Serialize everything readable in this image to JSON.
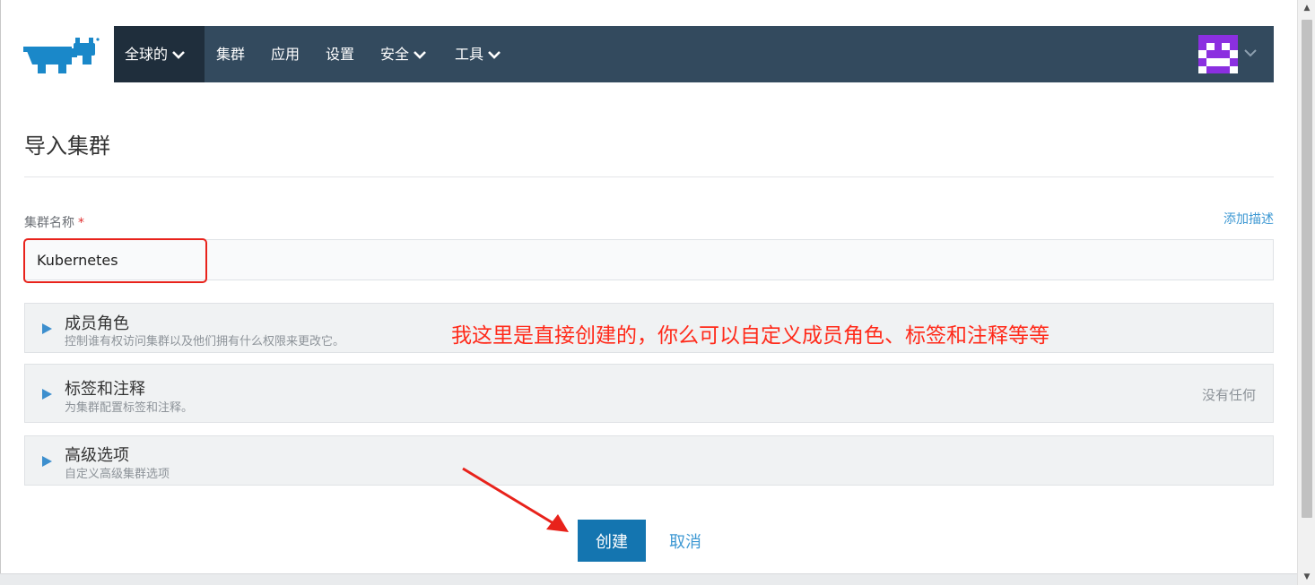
{
  "nav": {
    "global_label": "全球的",
    "items": [
      "集群",
      "应用",
      "设置"
    ],
    "security_label": "安全",
    "tools_label": "工具"
  },
  "page": {
    "title": "导入集群",
    "add_description": "添加描述"
  },
  "form": {
    "cluster_name_label": "集群名称",
    "required_mark": "*",
    "cluster_name_value": "Kubernetes"
  },
  "sections": [
    {
      "title": "成员角色",
      "subtitle": "控制谁有权访问集群以及他们拥有什么权限来更改它。",
      "status": ""
    },
    {
      "title": "标签和注释",
      "subtitle": "为集群配置标签和注释。",
      "status": "没有任何"
    },
    {
      "title": "高级选项",
      "subtitle": "自定义高级集群选项",
      "status": ""
    }
  ],
  "annotation": {
    "text": "我这里是直接创建的，你么可以自定义成员角色、标签和注释等等",
    "color": "#ff2a1a"
  },
  "actions": {
    "create_label": "创建",
    "cancel_label": "取消"
  },
  "colors": {
    "navbar": "#334a5e",
    "navbar_active": "#1f2e3c",
    "primary": "#1475b0",
    "link": "#3d98d3",
    "logo": "#1a88c9",
    "avatar": "#8b2fe0"
  },
  "icons": {
    "logo": "rancher-logo",
    "avatar": "identicon-avatar",
    "expand": "triangle-right-icon",
    "dropdown": "chevron-down-icon"
  }
}
